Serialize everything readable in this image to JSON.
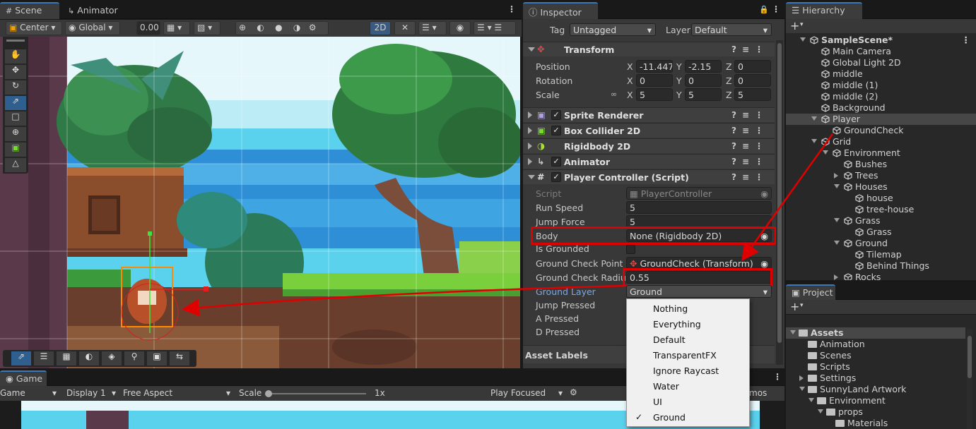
{
  "scene_tabs": {
    "scene": "Scene",
    "animator": "Animator"
  },
  "scene_toolbar": {
    "pivot": "Center",
    "space": "Global",
    "snap_value": "0.00",
    "mode_2d": "2D"
  },
  "inspector": {
    "tab": "Inspector",
    "tag_label": "Tag",
    "tag_value": "Untagged",
    "layer_label": "Layer",
    "layer_value": "Default",
    "transform": {
      "title": "Transform",
      "position_label": "Position",
      "rotation_label": "Rotation",
      "scale_label": "Scale",
      "position": {
        "x": "-11.4474",
        "y": "-2.15",
        "z": "0"
      },
      "rotation": {
        "x": "0",
        "y": "0",
        "z": "0"
      },
      "scale": {
        "x": "5",
        "y": "5",
        "z": "5"
      }
    },
    "components": [
      "Sprite Renderer",
      "Box Collider 2D",
      "Rigidbody 2D",
      "Animator",
      "Player Controller (Script)"
    ],
    "script": {
      "script_label": "Script",
      "script_value": "PlayerController",
      "run_speed_label": "Run Speed",
      "run_speed": "5",
      "jump_force_label": "Jump Force",
      "jump_force": "5",
      "body_label": "Body",
      "body_value": "None (Rigidbody 2D)",
      "is_grounded_label": "Is Grounded",
      "ground_check_point_label": "Ground Check Point",
      "ground_check_point_value": "GroundCheck (Transform)",
      "ground_check_radius_label": "Ground Check Radius",
      "ground_check_radius": "0.55",
      "ground_layer_label": "Ground Layer",
      "ground_layer_value": "Ground",
      "jump_pressed_label": "Jump Pressed",
      "a_pressed_label": "A Pressed",
      "d_pressed_label": "D Pressed"
    },
    "asset_labels": "Asset Labels"
  },
  "layer_dropdown": {
    "options": [
      "Nothing",
      "Everything",
      "Default",
      "TransparentFX",
      "Ignore Raycast",
      "Water",
      "UI",
      "Ground"
    ],
    "checked": "Ground"
  },
  "hierarchy": {
    "tab": "Hierarchy",
    "add": "+",
    "scene": "SampleScene*",
    "items": [
      "Main Camera",
      "Global Light 2D",
      "middle",
      "middle (1)",
      "middle (2)",
      "Background",
      "Player",
      "GroundCheck",
      "Grid",
      "Environment",
      "Bushes",
      "Trees",
      "Houses",
      "house",
      "tree-house",
      "Grass",
      "Grass",
      "Ground",
      "Tilemap",
      "Behind Things",
      "Rocks"
    ]
  },
  "project": {
    "tab": "Project",
    "add": "+",
    "folders": [
      "Assets",
      "Animation",
      "Scenes",
      "Scripts",
      "Settings",
      "SunnyLand Artwork",
      "Environment",
      "props",
      "Materials"
    ]
  },
  "game": {
    "tab": "Game",
    "mode": "Game",
    "display": "Display 1",
    "aspect": "Free Aspect",
    "scale_label": "Scale",
    "scale_value": "1x",
    "play_focused": "Play Focused",
    "gizmos": "mos"
  },
  "colors": {
    "accent": "#3a79bb",
    "highlight": "#e00000",
    "panel": "#383838",
    "dark": "#282828"
  }
}
